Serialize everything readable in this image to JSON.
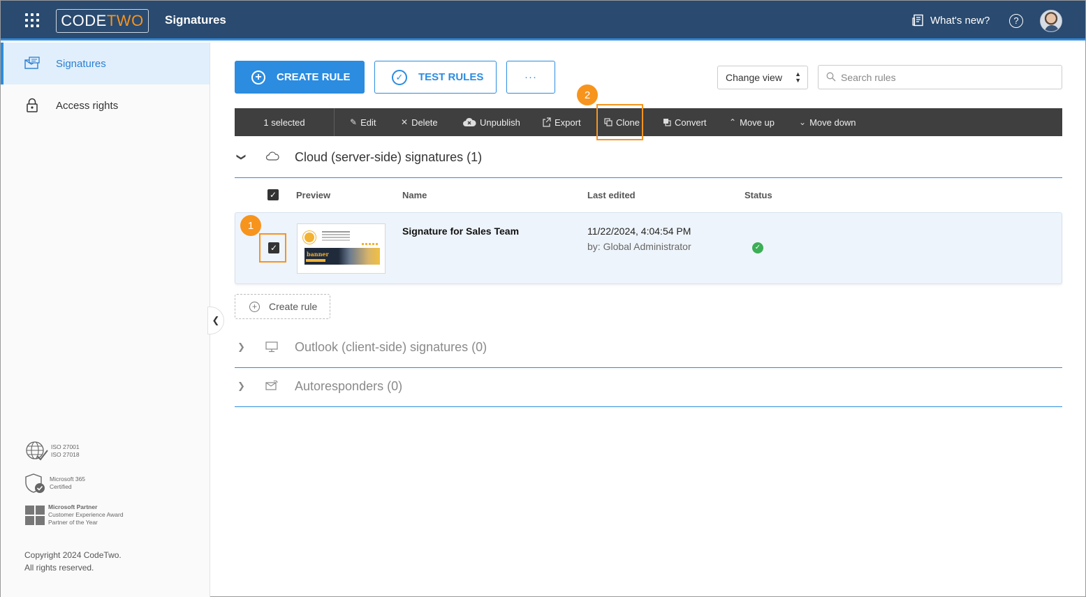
{
  "header": {
    "logo_code": "CODE",
    "logo_two": "TWO",
    "app_title": "Signatures",
    "whats_new": "What's new?",
    "help": "?"
  },
  "sidebar": {
    "items": [
      {
        "label": "Signatures",
        "icon": "signature-envelope-icon",
        "active": true
      },
      {
        "label": "Access rights",
        "icon": "lock-icon",
        "active": false
      }
    ],
    "badges": [
      {
        "icon": "globe-check-icon",
        "lines": [
          "ISO 27001",
          "ISO 27018"
        ]
      },
      {
        "icon": "shield-check-icon",
        "lines": [
          "Microsoft 365",
          "Certified"
        ]
      },
      {
        "icon": "microsoft-logo-icon",
        "lines": [
          "Microsoft Partner",
          "Customer Experience Award",
          "Partner of the Year"
        ]
      }
    ],
    "copyright_line1": "Copyright 2024 CodeTwo.",
    "copyright_line2": "All rights reserved."
  },
  "actions": {
    "create_rule": "CREATE RULE",
    "test_rules": "TEST RULES",
    "more": "···",
    "change_view": "Change view",
    "search_placeholder": "Search rules"
  },
  "toolbar": {
    "selected": "1 selected",
    "items": [
      "Edit",
      "Delete",
      "Unpublish",
      "Export",
      "Clone",
      "Convert",
      "Move up",
      "Move down"
    ]
  },
  "markers": [
    "1",
    "2"
  ],
  "groups": {
    "cloud": "Cloud (server-side) signatures (1)",
    "outlook": "Outlook (client-side) signatures (0)",
    "autoresponders": "Autoresponders (0)"
  },
  "table": {
    "headers": {
      "preview": "Preview",
      "name": "Name",
      "last_edited": "Last edited",
      "status": "Status"
    },
    "rows": [
      {
        "name": "Signature for Sales Team",
        "date": "11/22/2024, 4:04:54 PM",
        "by": "by: Global Administrator",
        "preview_banner": "banner",
        "status": "published",
        "checked": true
      }
    ]
  },
  "create_rule_inline": "Create rule",
  "colors": {
    "topbar": "#2a4a6f",
    "accent": "#2b8ce0",
    "marker": "#f7941d",
    "toolbar": "#3f3f3f",
    "status_ok": "#3cae55"
  }
}
